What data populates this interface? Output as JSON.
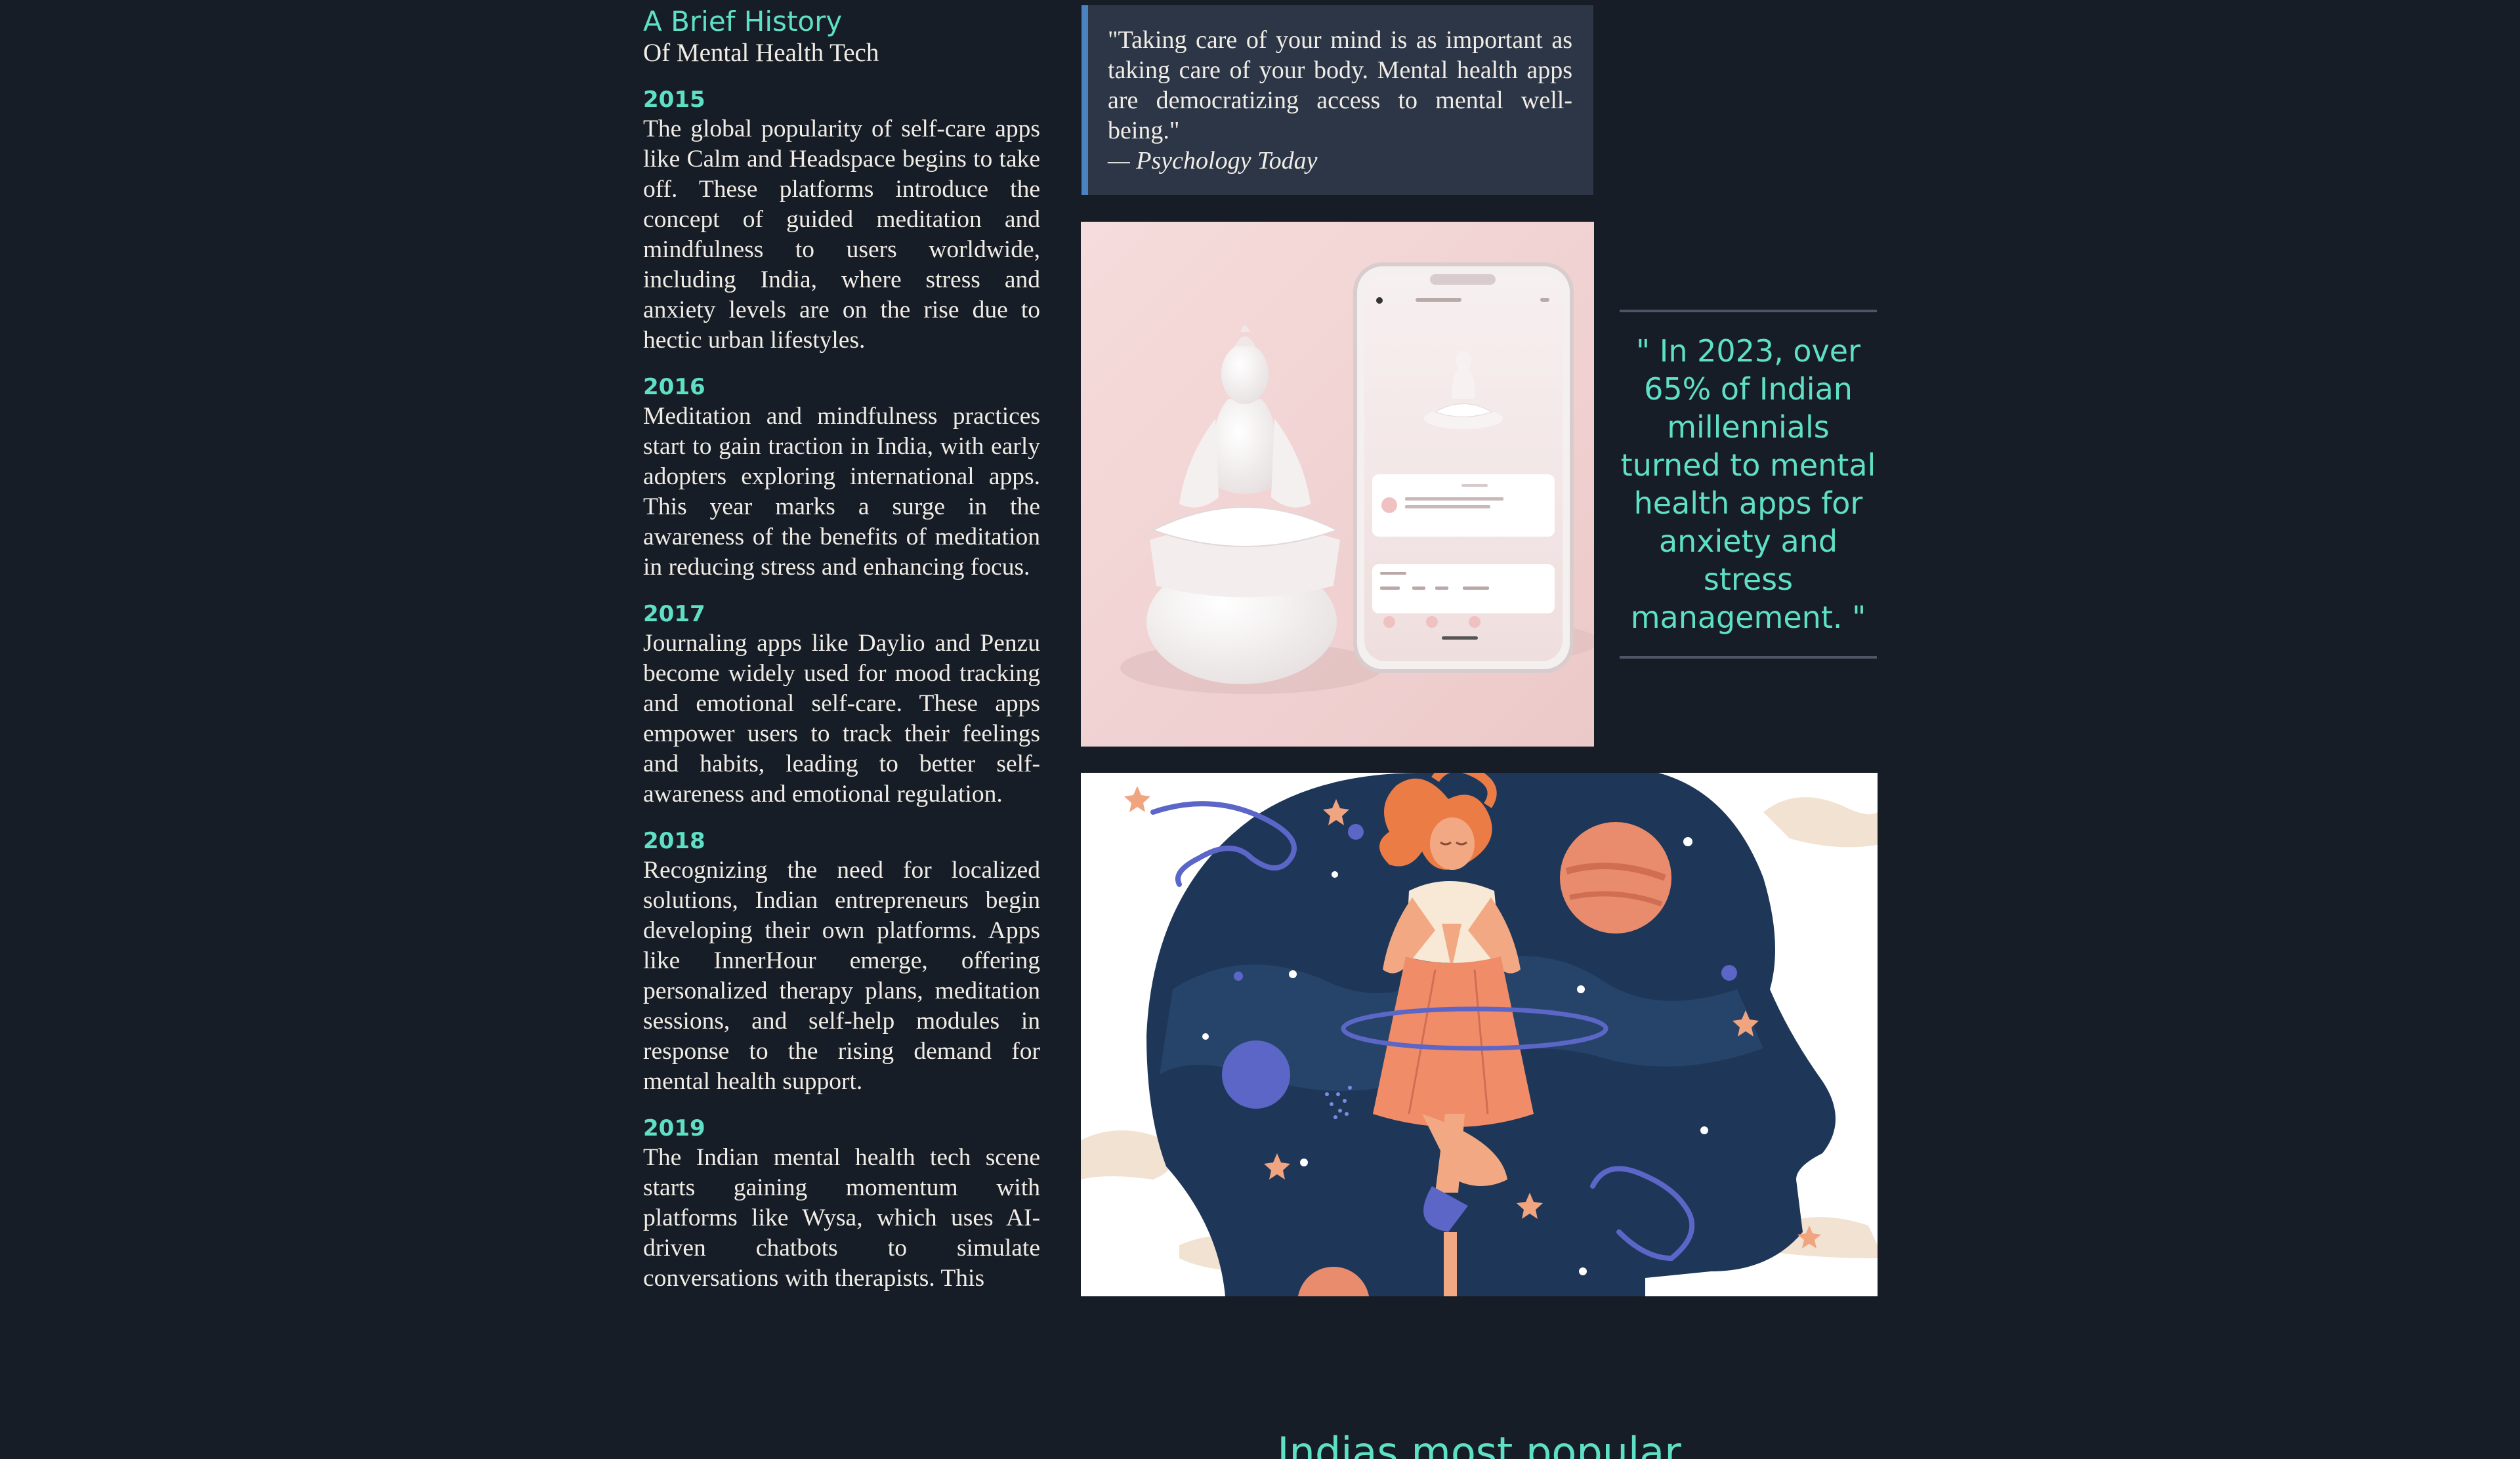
{
  "history": {
    "title": "A Brief History",
    "subtitle": "Of Mental Health Tech",
    "entries": [
      {
        "year": "2015",
        "text": "The global popularity of self-care apps like Calm and Headspace begins to take off. These platforms introduce the concept of guided meditation and mindfulness to users worldwide, including India, where stress and anxiety levels are on the rise due to hectic urban lifestyles."
      },
      {
        "year": "2016",
        "text": "Meditation and mindfulness practices start to gain traction in India, with early adopters exploring international apps. This year marks a surge in the awareness of the benefits of meditation in reducing stress and enhancing focus."
      },
      {
        "year": "2017",
        "text": "Journaling apps like Daylio and Penzu become widely used for mood tracking and emotional self-care. These apps empower users to track their feelings and habits, leading to better self-awareness and emotional regulation."
      },
      {
        "year": "2018",
        "text": "Recognizing the need for localized solutions, Indian entrepreneurs begin developing their own platforms. Apps like InnerHour emerge, offering personalized therapy plans, meditation sessions, and self-help modules in response to the rising demand for mental health support."
      },
      {
        "year": "2019",
        "text": "The Indian mental health tech scene starts gaining momentum with platforms like Wysa, which uses AI-driven chatbots to simulate conversations with therapists. This"
      }
    ]
  },
  "quote": {
    "text": "\"Taking care of your mind is as important as taking care of your body. Mental health apps are democratizing access to mental well-being.\"",
    "source": "— Psychology Today"
  },
  "stat": {
    "text": "\" In 2023, over 65% of Indian millennials turned to mental health apps for anxiety and stress management. \""
  },
  "section_heading": "Indias most popular",
  "colors": {
    "background": "#171d26",
    "accent_teal": "#5fe0c6",
    "quote_card": "#2c3646",
    "quote_border": "#4b82c0",
    "body_text": "#f1ede6"
  }
}
